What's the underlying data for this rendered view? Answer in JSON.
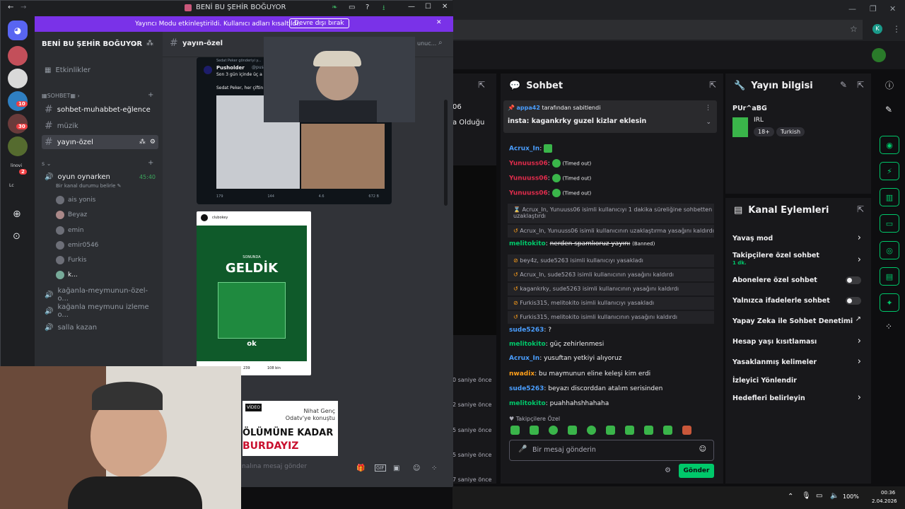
{
  "discord": {
    "window_title": "BENİ BU ŞEHİR BOĞUYOR",
    "banner_text": "Yayıncı Modu etkinleştirildi. Kullanıcı adları kısaltıldı.",
    "banner_button": "Devre dışı bırak",
    "server_name": "BENİ BU ŞEHİR BOĞUYOR",
    "events_label": "Etkinlikler",
    "category": "SOHBET",
    "text_channels": [
      "sohbet-muhabbet-eğlence",
      "müzik",
      "yayın-özel"
    ],
    "voice_category": "s",
    "voice_channel": "oyun oynarken",
    "voice_time": "45:40",
    "voice_status": "Bir kanal durumu belirle",
    "voice_users": [
      "ais yonis",
      "Beyaz",
      "emin",
      "emir0546",
      "Furkis",
      "k..."
    ],
    "other_voice": [
      "kağanla-meymunun-özel-o...",
      "kağanla meymunu izleme o...",
      "salla kazan"
    ],
    "header_channel": "yayın-özel",
    "search_placeholder": "unuc...",
    "message_placeholder": "nalına mesaj gönder",
    "guild_badges": [
      "10",
      "30",
      "2"
    ],
    "guild_labels": [
      "linovi",
      "Lc"
    ],
    "tweet_author": "Pusholder",
    "tweet_handle": "@pusho",
    "tweet_reposted_by": "Sedat Peker gönderiyi y...",
    "tweet_line1": "Son 3 gün içinde üç a",
    "tweet_line2": "Sedat Peker, her çiftin",
    "tweet_stats": [
      "179",
      "144",
      "4.6",
      "672 B"
    ],
    "insta_account": "clubokey",
    "insta_sub": "SONUNDA",
    "insta_title": "GELDİK",
    "insta_logo": "ok",
    "insta_stats": [
      "239",
      "108 bin"
    ],
    "news_line1": "Nihat Genç",
    "news_line2": "Odatv'ye konuştu",
    "news_line3": "ÖLÜMÜNE KADAR",
    "news_line4": "BURDAYIZ",
    "news_tag": "VİDEO"
  },
  "twitch": {
    "chat_title": "Sohbet",
    "pinned_by": "appa42",
    "pinned_by_suffix": "tarafından sabitlendi",
    "pinned_text": "insta: kagankrky guzel kizlar eklesin",
    "messages": [
      {
        "user": "Acrux_In",
        "color": "#4a9eff",
        "text": "",
        "tag": ""
      },
      {
        "user": "Yunuuss06",
        "color": "#e02c4c",
        "text": "",
        "tag": "(Timed out)"
      },
      {
        "user": "Yunuuss06",
        "color": "#e02c4c",
        "text": "",
        "tag": "(Timed out)"
      },
      {
        "user": "Yunuuss06",
        "color": "#e02c4c",
        "text": "",
        "tag": "(Timed out)"
      }
    ],
    "sys_timeout": "Acrux_In, Yunuuss06 isimli kullanıcıyı 1 dakika süreliğine sohbetten",
    "sys_timeout2": "uzaklaştırdı",
    "sys_lift": "Acrux_In, Yunuuss06 isimli kullanıcının uzaklaştırma yasağını kaldırdı",
    "banned_user": "melitokito",
    "banned_text": "nerden spamlıoruz yayını",
    "banned_tag": "(Banned)",
    "sys_events": [
      "bey4z, sude5263 isimli kullanıcıyı yasakladı",
      "Acrux_In, sude5263 isimli kullanıcının yasağını kaldırdı",
      "kagankrky, sude5263 isimli kullanıcının yasağını kaldırdı",
      "Furkis315, melitokito isimli kullanıcıyı yasakladı",
      "Furkis315, melitokito isimli kullanıcının yasağını kaldırdı"
    ],
    "chat": [
      {
        "user": "sude5263",
        "color": "#4a9eff",
        "text": "?"
      },
      {
        "user": "melitokito",
        "color": "#00c86a",
        "text": "güç zehirlenmesi"
      },
      {
        "user": "Acrux_In",
        "color": "#4a9eff",
        "text": "yusuftan yetkiyi alıyoruz"
      },
      {
        "user": "nwadix",
        "color": "#ff9f1a",
        "text": "bu maymunun eline keleşi kim erdi"
      },
      {
        "user": "sude5263",
        "color": "#4a9eff",
        "text": "beyazı discorddan atalım serisinden"
      },
      {
        "user": "melitokito",
        "color": "#00c86a",
        "text": "puahhahshhahaha"
      }
    ],
    "followers_only": "Takipçilere Özel",
    "input_placeholder": "Bir mesaj gönderin",
    "send_label": "Gönder",
    "stream_info_title": "Yayın bilgisi",
    "stream_title": "PUr^aBG",
    "category": "IRL",
    "tags": [
      "18+",
      "Turkish"
    ],
    "actions_title": "Kanal Eylemleri",
    "actions": [
      "Yavaş mod",
      "Takipçilere özel sohbet",
      "Abonelere özel sohbet",
      "Yalnızca ifadelerle sohbet",
      "Yapay Zeka ile Sohbet Denetimi",
      "Hesap yaşı kısıtlaması",
      "Yasaklanmış kelimeler",
      "İzleyici Yönlendir",
      "Hedefleri belirleyin"
    ],
    "followers_sub": "1 dk.",
    "left_snippets": [
      "06",
      "a Olduğu"
    ],
    "times": [
      "0 saniye önce",
      "2 saniye önce",
      "5 saniye önce",
      "5 saniye önce",
      "7 saniye önce"
    ]
  },
  "taskbar": {
    "battery": "100%",
    "time": "00:36",
    "date": "2.04.2026"
  }
}
